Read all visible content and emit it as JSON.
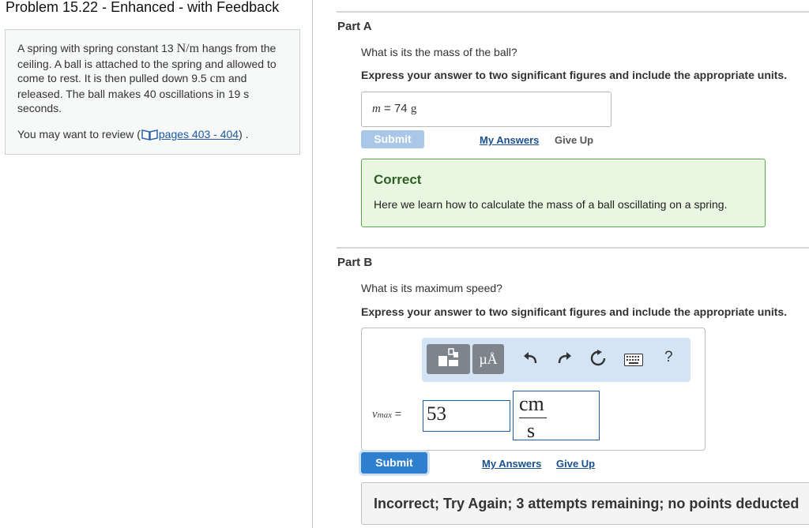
{
  "problem": {
    "title": "Problem 15.22 - Enhanced - with Feedback",
    "text_1": "A spring with spring constant 13 ",
    "text_unit": "N/m",
    "text_2": " hangs from the ceiling. A ball is attached to the spring and allowed to come to rest. It is then pulled down 9.5 ",
    "text_unit2": "cm",
    "text_3": " and released. The ball makes 40 oscillations in 19 s seconds.",
    "review_prefix": "You may want to review (",
    "review_link": "pages 403 - 404",
    "review_suffix": ") ."
  },
  "part_a": {
    "label": "Part A",
    "question": "What is its the mass of the ball?",
    "instruction": "Express your answer to two significant figures and include the appropriate units.",
    "answer_var": "m",
    "answer_eq": " = ",
    "answer_value": "74 ",
    "answer_unit": "g",
    "submit_label": "Submit",
    "my_answers_label": "My Answers",
    "give_up_label": "Give Up",
    "feedback_title": "Correct",
    "feedback_text": "Here we learn how to calculate the mass of a ball oscillating on a spring."
  },
  "part_b": {
    "label": "Part B",
    "question": "What is its maximum speed?",
    "instruction": "Express your answer to two significant figures and include the appropriate units.",
    "var_main": "v",
    "var_sub": "max",
    "var_eq": " =",
    "value": "53",
    "unit_num": "cm",
    "unit_den": "s",
    "toolbar_units_glyph": "µÅ",
    "help_label": "?",
    "submit_label": "Submit",
    "my_answers_label": "My Answers",
    "give_up_label": "Give Up",
    "feedback_text": "Incorrect; Try Again; 3 attempts remaining; no points deducted"
  },
  "colors": {
    "accent": "#2f7fd0",
    "correct_border": "#59a84a",
    "correct_bg": "#e9f6e2",
    "link": "#1a4f8f"
  },
  "icons": [
    "book-icon",
    "templates-icon",
    "undo-icon",
    "redo-icon",
    "reset-icon",
    "keyboard-icon",
    "help-icon"
  ]
}
